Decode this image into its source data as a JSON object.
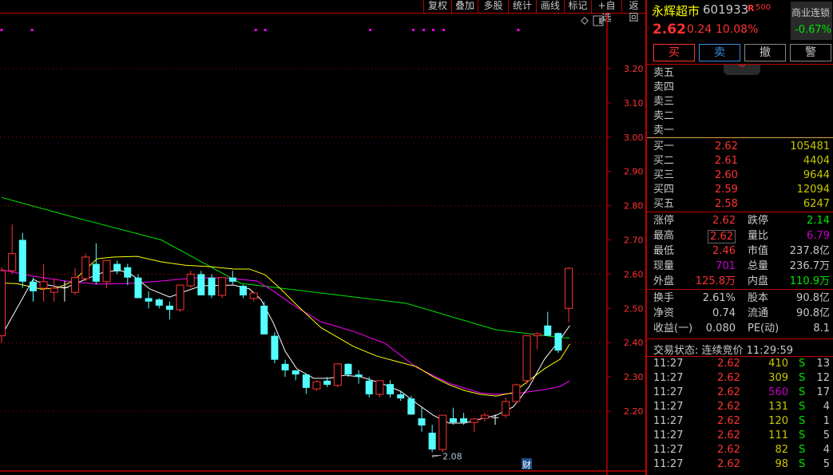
{
  "toolbar": {
    "items": [
      "复权",
      "叠加",
      "多股",
      "统计",
      "画线",
      "标记",
      "+自选",
      "返回"
    ]
  },
  "stock": {
    "name": "永辉超市",
    "code": "601933",
    "badge": "R",
    "badge_sub": "500",
    "price": "2.62",
    "change": "0.24",
    "change_pct": "10.08%",
    "sector": "商业连锁",
    "sector_change": "-0.67%"
  },
  "actions": {
    "buy": "买",
    "sell": "卖",
    "cancel": "撤",
    "alert": "警"
  },
  "asks": [
    {
      "label": "卖五"
    },
    {
      "label": "卖四"
    },
    {
      "label": "卖三"
    },
    {
      "label": "卖二"
    },
    {
      "label": "卖一"
    }
  ],
  "bids": [
    {
      "label": "买一",
      "price": "2.62",
      "vol": "105481"
    },
    {
      "label": "买二",
      "price": "2.61",
      "vol": "4404"
    },
    {
      "label": "买三",
      "price": "2.60",
      "vol": "9644"
    },
    {
      "label": "买四",
      "price": "2.59",
      "vol": "12094"
    },
    {
      "label": "买五",
      "price": "2.58",
      "vol": "6247"
    }
  ],
  "stats1": [
    {
      "l1": "涨停",
      "v1": "2.62",
      "l2": "跌停",
      "v2": "2.14"
    },
    {
      "l1": "最高",
      "v1": "2.62",
      "l2": "量比",
      "v2": "6.79"
    },
    {
      "l1": "最低",
      "v1": "2.46",
      "l2": "市值",
      "v2": "237.8亿"
    },
    {
      "l1": "现量",
      "v1": "701",
      "l2": "总量",
      "v2": "236.7万"
    },
    {
      "l1": "外盘",
      "v1": "125.8万",
      "l2": "内盘",
      "v2": "110.9万"
    }
  ],
  "stats2": [
    {
      "l1": "换手",
      "v1": "2.61%",
      "l2": "股本",
      "v2": "90.8亿"
    },
    {
      "l1": "净资",
      "v1": "0.74",
      "l2": "流通",
      "v2": "90.8亿"
    },
    {
      "l1": "收益(一)",
      "v1": "0.080",
      "l2": "PE(动)",
      "v2": "8.1"
    }
  ],
  "trade_status": "交易状态: 连续竞价 11:29:59",
  "ticks": [
    {
      "t": "11:27",
      "p": "2.62",
      "v": "410",
      "s": "S",
      "n": "13"
    },
    {
      "t": "11:27",
      "p": "2.62",
      "v": "309",
      "s": "S",
      "n": "12"
    },
    {
      "t": "11:27",
      "p": "2.62",
      "v": "560",
      "s": "S",
      "n": "17",
      "big": true
    },
    {
      "t": "11:27",
      "p": "2.62",
      "v": "131",
      "s": "S",
      "n": "4"
    },
    {
      "t": "11:27",
      "p": "2.62",
      "v": "120",
      "s": "S",
      "n": "1"
    },
    {
      "t": "11:27",
      "p": "2.62",
      "v": "111",
      "s": "S",
      "n": "5"
    },
    {
      "t": "11:27",
      "p": "2.62",
      "v": "82",
      "s": "S",
      "n": "4"
    },
    {
      "t": "11:27",
      "p": "2.62",
      "v": "98",
      "s": "S",
      "n": "5"
    }
  ],
  "chart_data": {
    "type": "candlestick",
    "ylim": [
      2.05,
      3.25
    ],
    "yticks": [
      "3.20",
      "3.10",
      "3.00",
      "2.90",
      "2.80",
      "2.70",
      "2.60",
      "2.50",
      "2.40",
      "2.30",
      "2.20"
    ],
    "low_label": "2.08",
    "badge": "财",
    "colors": {
      "up": "#ff3232",
      "down": "#54ffff",
      "ma5": "#ffffff",
      "ma10": "#ffff00",
      "ma20": "#ff00ff",
      "ma60": "#00e600"
    },
    "candles": [
      [
        2.42,
        2.62,
        2.4,
        2.61
      ],
      [
        2.61,
        2.745,
        2.6,
        2.66
      ],
      [
        2.7,
        2.72,
        2.56,
        2.578
      ],
      [
        2.578,
        2.59,
        2.52,
        2.55
      ],
      [
        2.559,
        2.63,
        2.52,
        2.578
      ],
      [
        2.547,
        2.587,
        2.52,
        2.559
      ],
      [
        2.56,
        2.58,
        2.52,
        2.561
      ],
      [
        2.547,
        2.617,
        2.54,
        2.59
      ],
      [
        2.587,
        2.66,
        2.58,
        2.65
      ],
      [
        2.63,
        2.69,
        2.57,
        2.578
      ],
      [
        2.578,
        2.64,
        2.56,
        2.64
      ],
      [
        2.63,
        2.64,
        2.6,
        2.61
      ],
      [
        2.62,
        2.63,
        2.568,
        2.59
      ],
      [
        2.59,
        2.6,
        2.53,
        2.53
      ],
      [
        2.53,
        2.55,
        2.5,
        2.52
      ],
      [
        2.526,
        2.53,
        2.5,
        2.508
      ],
      [
        2.508,
        2.52,
        2.468,
        2.496
      ],
      [
        2.496,
        2.57,
        2.49,
        2.568
      ],
      [
        2.566,
        2.61,
        2.56,
        2.6
      ],
      [
        2.6,
        2.61,
        2.538,
        2.538
      ],
      [
        2.59,
        2.6,
        2.53,
        2.538
      ],
      [
        2.538,
        2.59,
        2.53,
        2.59
      ],
      [
        2.59,
        2.61,
        2.57,
        2.578
      ],
      [
        2.566,
        2.57,
        2.53,
        2.538
      ],
      [
        2.529,
        2.545,
        2.52,
        2.545
      ],
      [
        2.508,
        2.52,
        2.424,
        2.424
      ],
      [
        2.42,
        2.43,
        2.34,
        2.35
      ],
      [
        2.338,
        2.35,
        2.3,
        2.319
      ],
      [
        2.319,
        2.32,
        2.29,
        2.307
      ],
      [
        2.307,
        2.31,
        2.25,
        2.268
      ],
      [
        2.265,
        2.29,
        2.26,
        2.286
      ],
      [
        2.289,
        2.3,
        2.27,
        2.277
      ],
      [
        2.275,
        2.34,
        2.27,
        2.338
      ],
      [
        2.338,
        2.34,
        2.3,
        2.307
      ],
      [
        2.307,
        2.32,
        2.28,
        2.3
      ],
      [
        2.289,
        2.3,
        2.24,
        2.249
      ],
      [
        2.249,
        2.29,
        2.24,
        2.289
      ],
      [
        2.279,
        2.29,
        2.24,
        2.249
      ],
      [
        2.249,
        2.26,
        2.23,
        2.237
      ],
      [
        2.237,
        2.245,
        2.19,
        2.19
      ],
      [
        2.179,
        2.21,
        2.14,
        2.158
      ],
      [
        2.137,
        2.16,
        2.08,
        2.088
      ],
      [
        2.088,
        2.188,
        2.08,
        2.188
      ],
      [
        2.179,
        2.21,
        2.16,
        2.167
      ],
      [
        2.179,
        2.195,
        2.16,
        2.167
      ],
      [
        2.167,
        2.18,
        2.14,
        2.177
      ],
      [
        2.179,
        2.195,
        2.17,
        2.188
      ],
      [
        2.18,
        2.19,
        2.16,
        2.181
      ],
      [
        2.188,
        2.24,
        2.18,
        2.228
      ],
      [
        2.228,
        2.28,
        2.22,
        2.277
      ],
      [
        2.289,
        2.42,
        2.28,
        2.42
      ],
      [
        2.42,
        2.43,
        2.38,
        2.426
      ],
      [
        2.45,
        2.49,
        2.42,
        2.42
      ],
      [
        2.428,
        2.43,
        2.37,
        2.377
      ],
      [
        2.5,
        2.62,
        2.46,
        2.617
      ]
    ],
    "ma5": [
      [
        0,
        2.42
      ],
      [
        3,
        2.585
      ],
      [
        4,
        2.571
      ],
      [
        6,
        2.559
      ],
      [
        8,
        2.585
      ],
      [
        9.9,
        2.608
      ],
      [
        11.4,
        2.61
      ],
      [
        12.5,
        2.596
      ],
      [
        14.1,
        2.557
      ],
      [
        16,
        2.533
      ],
      [
        17.5,
        2.55
      ],
      [
        19,
        2.566
      ],
      [
        22.1,
        2.568
      ],
      [
        23.6,
        2.557
      ],
      [
        24.7,
        2.526
      ],
      [
        25.9,
        2.456
      ],
      [
        27,
        2.375
      ],
      [
        28.1,
        2.324
      ],
      [
        29.7,
        2.296
      ],
      [
        31.2,
        2.296
      ],
      [
        32.7,
        2.305
      ],
      [
        34.2,
        2.3
      ],
      [
        36.1,
        2.282
      ],
      [
        38,
        2.258
      ],
      [
        39.5,
        2.223
      ],
      [
        41.1,
        2.188
      ],
      [
        42.6,
        2.165
      ],
      [
        44.1,
        2.165
      ],
      [
        45.6,
        2.177
      ],
      [
        47.1,
        2.188
      ],
      [
        48.7,
        2.212
      ],
      [
        50.2,
        2.27
      ],
      [
        51.7,
        2.352
      ],
      [
        53.2,
        2.41
      ],
      [
        54.1,
        2.45
      ]
    ],
    "ma10": [
      [
        0,
        2.574
      ],
      [
        1.5,
        2.572
      ],
      [
        3.8,
        2.556
      ],
      [
        5.3,
        2.56
      ],
      [
        6.8,
        2.579
      ],
      [
        8,
        2.614
      ],
      [
        9.1,
        2.645
      ],
      [
        10.6,
        2.65
      ],
      [
        12.9,
        2.652
      ],
      [
        15.2,
        2.636
      ],
      [
        17.5,
        2.626
      ],
      [
        19.8,
        2.622
      ],
      [
        22.1,
        2.615
      ],
      [
        23.6,
        2.615
      ],
      [
        25.1,
        2.598
      ],
      [
        26.6,
        2.556
      ],
      [
        28.1,
        2.51
      ],
      [
        30.4,
        2.444
      ],
      [
        33.5,
        2.389
      ],
      [
        35.7,
        2.361
      ],
      [
        38,
        2.342
      ],
      [
        39.5,
        2.33
      ],
      [
        41.1,
        2.3
      ],
      [
        42.6,
        2.277
      ],
      [
        44.1,
        2.26
      ],
      [
        45.6,
        2.249
      ],
      [
        47.1,
        2.244
      ],
      [
        48.7,
        2.254
      ],
      [
        50.2,
        2.289
      ],
      [
        51.7,
        2.324
      ],
      [
        53.2,
        2.352
      ],
      [
        54.1,
        2.396
      ]
    ],
    "ma20": [
      [
        0,
        2.613
      ],
      [
        3,
        2.594
      ],
      [
        6.1,
        2.58
      ],
      [
        9.1,
        2.571
      ],
      [
        12.2,
        2.573
      ],
      [
        15.2,
        2.58
      ],
      [
        18.3,
        2.589
      ],
      [
        21.3,
        2.589
      ],
      [
        24.3,
        2.58
      ],
      [
        25.9,
        2.55
      ],
      [
        28.1,
        2.503
      ],
      [
        30.4,
        2.461
      ],
      [
        33.5,
        2.433
      ],
      [
        36.5,
        2.398
      ],
      [
        39.5,
        2.328
      ],
      [
        42.6,
        2.281
      ],
      [
        45.6,
        2.253
      ],
      [
        47.1,
        2.249
      ],
      [
        49.4,
        2.253
      ],
      [
        51.7,
        2.263
      ],
      [
        53.2,
        2.272
      ],
      [
        54.1,
        2.289
      ]
    ],
    "ma60": [
      [
        0,
        2.824
      ],
      [
        6.3,
        2.771
      ],
      [
        15.2,
        2.7
      ],
      [
        22.8,
        2.573
      ],
      [
        30.4,
        2.545
      ],
      [
        38.5,
        2.515
      ],
      [
        47,
        2.438
      ],
      [
        53.2,
        2.415
      ],
      [
        54.1,
        2.413
      ]
    ],
    "signal_marks": [
      0,
      2.9,
      24.2,
      25.1,
      35.1,
      39.2,
      40.2,
      41.1,
      42.1,
      49.2
    ]
  }
}
